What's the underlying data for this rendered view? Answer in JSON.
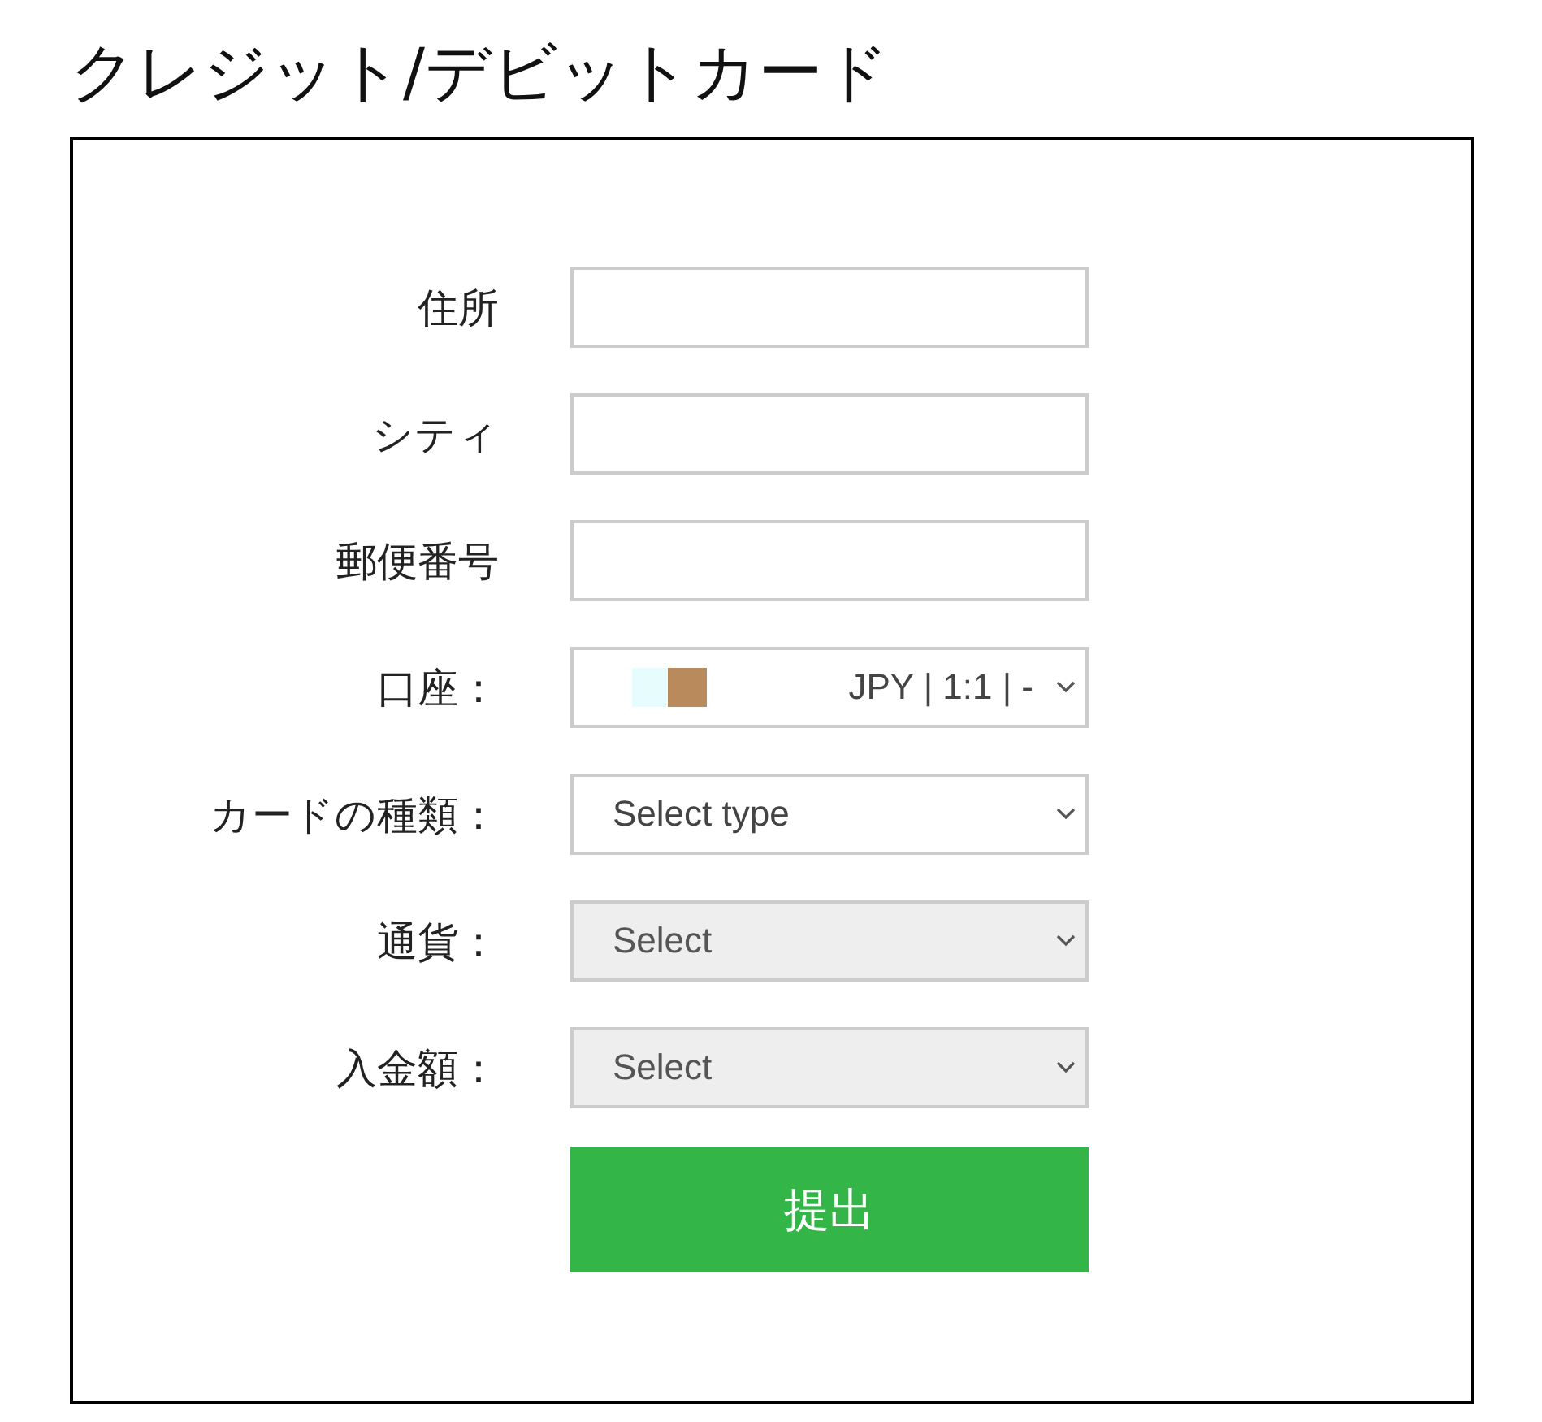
{
  "title": "クレジット/デビットカード",
  "fields": [
    {
      "label": "住所",
      "kind": "text"
    },
    {
      "label": "シティ",
      "kind": "text"
    },
    {
      "label": "郵便番号",
      "kind": "text"
    },
    {
      "label": "口座：",
      "kind": "account",
      "value": "JPY | 1:1 | -",
      "disabled": false
    },
    {
      "label": "カードの種類：",
      "kind": "select",
      "value": "Select type",
      "disabled": false
    },
    {
      "label": "通貨：",
      "kind": "select",
      "value": "Select",
      "disabled": true
    },
    {
      "label": "入金額：",
      "kind": "select",
      "value": "Select",
      "disabled": true
    }
  ],
  "submit": "提出"
}
